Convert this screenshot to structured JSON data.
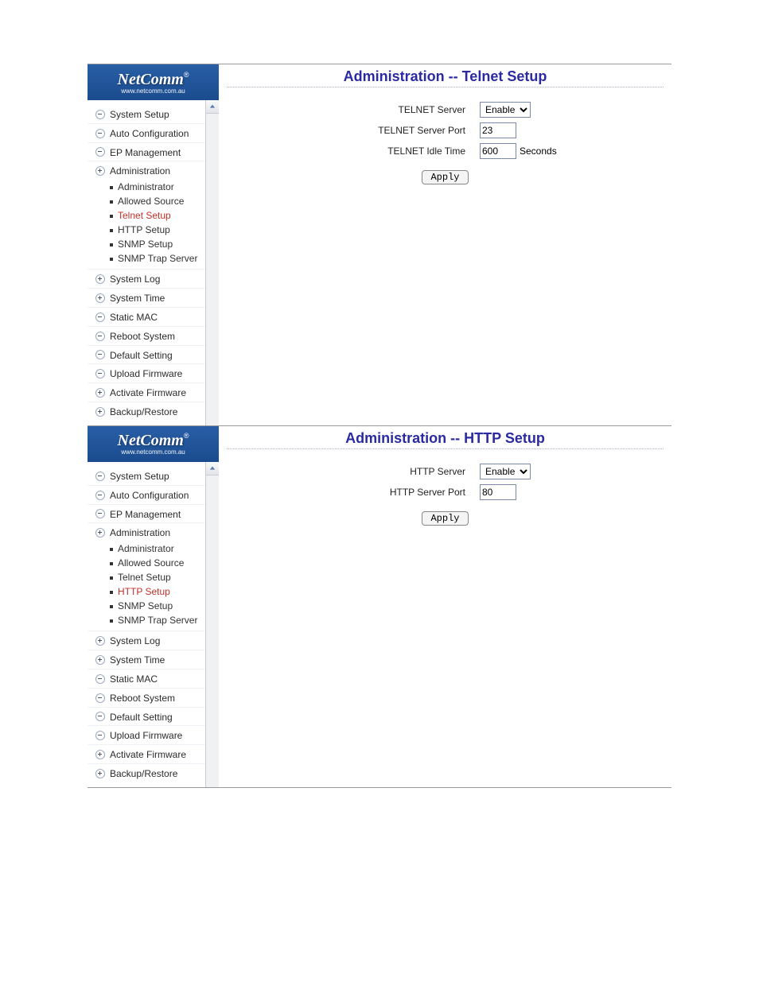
{
  "logo": {
    "brand": "NetComm",
    "reg": "®",
    "url": "www.netcomm.com.au"
  },
  "sidebar": {
    "items": [
      {
        "label": "System Setup",
        "icon": "minus"
      },
      {
        "label": "Auto Configuration",
        "icon": "minus"
      },
      {
        "label": "EP Management",
        "icon": "minus"
      },
      {
        "label": "Administration",
        "icon": "plus",
        "children": [
          {
            "label": "Administrator"
          },
          {
            "label": "Allowed Source"
          },
          {
            "label": "Telnet Setup",
            "active_in": "telnet"
          },
          {
            "label": "HTTP Setup",
            "active_in": "http"
          },
          {
            "label": "SNMP Setup"
          },
          {
            "label": "SNMP Trap Server"
          }
        ]
      },
      {
        "label": "System Log",
        "icon": "plus"
      },
      {
        "label": "System Time",
        "icon": "plus"
      },
      {
        "label": "Static MAC",
        "icon": "minus"
      },
      {
        "label": "Reboot System",
        "icon": "minus"
      },
      {
        "label": "Default Setting",
        "icon": "minus"
      },
      {
        "label": "Upload Firmware",
        "icon": "minus"
      },
      {
        "label": "Activate Firmware",
        "icon": "plus"
      },
      {
        "label": "Backup/Restore",
        "icon": "plus"
      }
    ]
  },
  "telnet": {
    "title": "Administration -- Telnet Setup",
    "server_label": "TELNET Server",
    "server_value": "Enable",
    "port_label": "TELNET Server Port",
    "port_value": "23",
    "idle_label": "TELNET Idle Time",
    "idle_value": "600",
    "idle_suffix": "Seconds",
    "apply": "Apply"
  },
  "http": {
    "title": "Administration -- HTTP Setup",
    "server_label": "HTTP Server",
    "server_value": "Enable",
    "port_label": "HTTP Server Port",
    "port_value": "80",
    "apply": "Apply"
  }
}
